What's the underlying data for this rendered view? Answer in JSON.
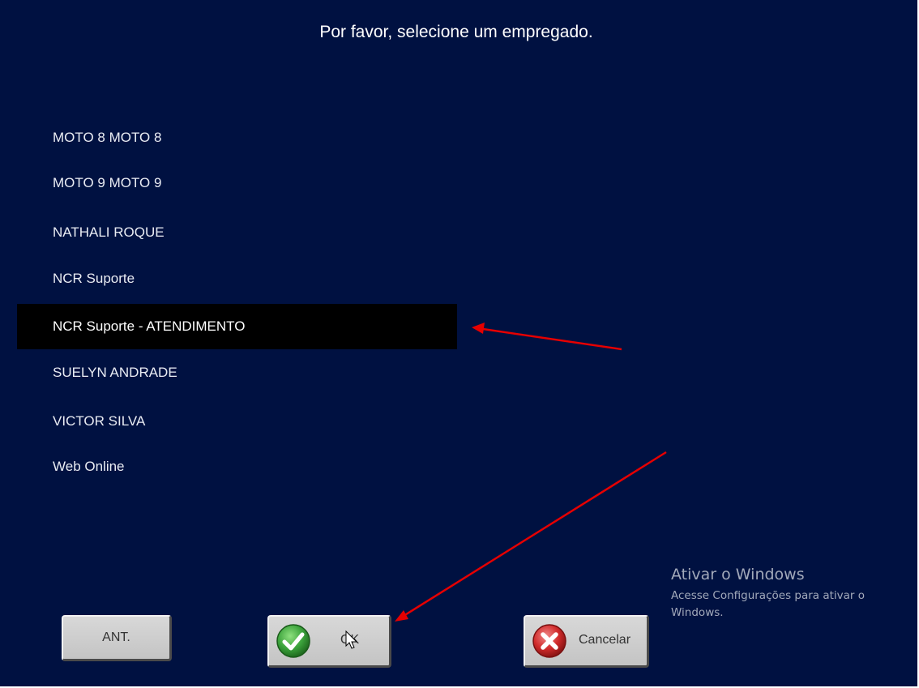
{
  "title": "Por favor, selecione um empregado.",
  "employees": [
    {
      "name": "MOTO 8 MOTO 8",
      "selected": false
    },
    {
      "name": "MOTO 9 MOTO 9",
      "selected": false
    },
    {
      "name": "NATHALI ROQUE",
      "selected": false
    },
    {
      "name": "NCR Suporte",
      "selected": false
    },
    {
      "name": "NCR Suporte - ATENDIMENTO",
      "selected": true
    },
    {
      "name": "SUELYN ANDRADE",
      "selected": false
    },
    {
      "name": "VICTOR SILVA",
      "selected": false
    },
    {
      "name": "Web Online",
      "selected": false
    }
  ],
  "buttons": {
    "prev_label": "ANT.",
    "ok_label": "OK",
    "cancel_label": "Cancelar",
    "ok_icon": "checkmark-icon",
    "cancel_icon": "close-x-icon"
  },
  "watermark": {
    "title": "Ativar o Windows",
    "text": "Acesse Configurações para ativar o Windows."
  },
  "colors": {
    "background": "#001141",
    "selected_row": "#000000",
    "annotation_arrow": "#e60000",
    "ok_icon": "#3ca33c",
    "cancel_icon": "#d12b2b"
  }
}
